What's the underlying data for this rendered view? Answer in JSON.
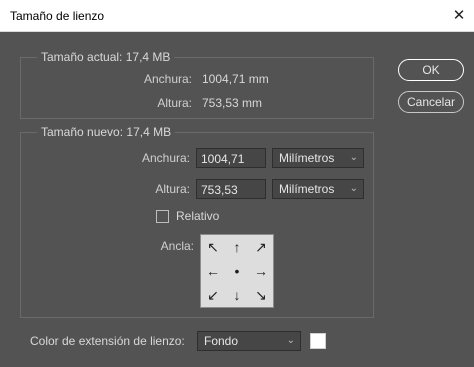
{
  "dialog": {
    "title": "Tamaño de lienzo",
    "close_glyph": "✕"
  },
  "current_size": {
    "legend": "Tamaño actual: 17,4 MB",
    "width_label": "Anchura:",
    "width_value": "1004,71 mm",
    "height_label": "Altura:",
    "height_value": "753,53 mm"
  },
  "new_size": {
    "legend": "Tamaño nuevo: 17,4 MB",
    "width_label": "Anchura:",
    "width_input": "1004,71",
    "width_unit": "Milímetros",
    "height_label": "Altura:",
    "height_input": "753,53",
    "height_unit": "Milímetros",
    "relative_label": "Relativo",
    "relative_checked": false,
    "anchor_label": "Ancla:",
    "anchor_cells": {
      "top_left": "↖",
      "top_center": "↑",
      "top_right": "↗",
      "middle_left": "←",
      "middle_center": "•",
      "middle_right": "→",
      "bottom_left": "↙",
      "bottom_center": "↓",
      "bottom_right": "↘"
    }
  },
  "buttons": {
    "ok": "OK",
    "cancel": "Cancelar"
  },
  "extension": {
    "label": "Color de extensión de lienzo:",
    "value": "Fondo",
    "swatch_color": "#ffffff"
  },
  "icons": {
    "close": "close-icon",
    "dropdown": "chevron-down-icon"
  }
}
